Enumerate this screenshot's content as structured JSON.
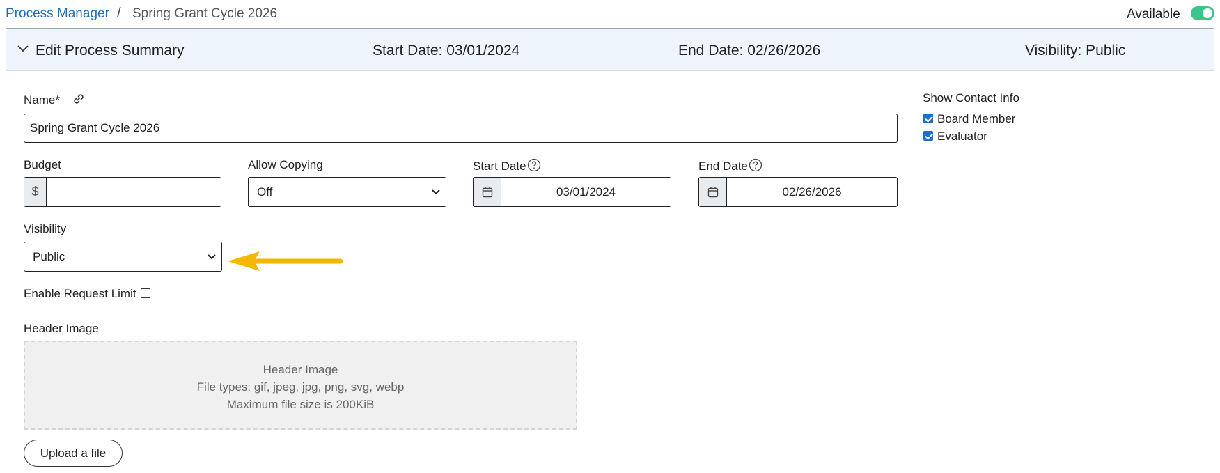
{
  "breadcrumb": {
    "parent": "Process Manager",
    "separator": "/",
    "current": "Spring Grant Cycle 2026"
  },
  "availability": {
    "label": "Available",
    "enabled": true
  },
  "summary": {
    "title": "Edit Process Summary",
    "start": "Start Date: 03/01/2024",
    "end": "End Date: 02/26/2026",
    "visibility": "Visibility: Public"
  },
  "form": {
    "name_label": "Name*",
    "name_value": "Spring Grant Cycle 2026",
    "budget_label": "Budget",
    "budget_prefix": "$",
    "budget_value": "",
    "copy_label": "Allow Copying",
    "copy_value": "Off",
    "start_label": "Start Date",
    "start_value": "03/01/2024",
    "end_label": "End Date",
    "end_value": "02/26/2026",
    "visibility_label": "Visibility",
    "visibility_value": "Public",
    "request_limit_label": "Enable Request Limit",
    "request_limit_checked": false,
    "header_image_label": "Header Image"
  },
  "contact": {
    "title": "Show Contact Info",
    "items": [
      {
        "label": "Board Member",
        "checked": true
      },
      {
        "label": "Evaluator",
        "checked": true
      }
    ]
  },
  "dropzone": {
    "line1": "Header Image",
    "line2": "File types: gif, jpeg, jpg, png, svg, webp",
    "line3": "Maximum file size is 200KiB"
  },
  "upload_label": "Upload a file",
  "colors": {
    "link": "#1f6fb8",
    "toggle_on": "#3cc48a",
    "header_bg": "#eef5fc",
    "arrow": "#f5b800",
    "checkbox": "#1b6fd0"
  }
}
